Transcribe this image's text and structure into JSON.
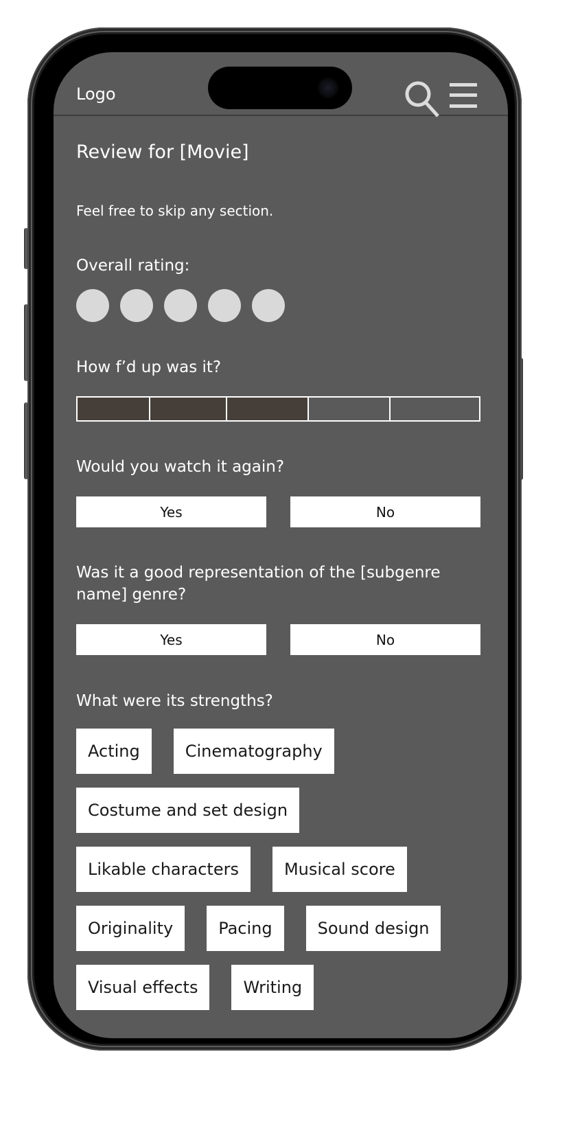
{
  "header": {
    "logo": "Logo",
    "icons": [
      "search-icon",
      "menu-icon"
    ]
  },
  "page": {
    "title": "Review for [Movie]",
    "subtitle": "Feel free to skip any section."
  },
  "overall_rating": {
    "label": "Overall rating:",
    "max": 5,
    "value": 0
  },
  "intensity": {
    "label": "How f’d up was it?",
    "segments": 5,
    "value": 3,
    "filled_color": "#463f39"
  },
  "watch_again": {
    "label": "Would you watch it again?",
    "options": [
      "Yes",
      "No"
    ]
  },
  "genre_rep": {
    "label": "Was it a good representation of the [subgenre name] genre?",
    "options": [
      "Yes",
      "No"
    ]
  },
  "strengths": {
    "label": "What were its strengths?",
    "rows": [
      [
        "Acting",
        "Cinematography"
      ],
      [
        "Costume and set design"
      ],
      [
        "Likable characters",
        "Musical score"
      ],
      [
        "Originality",
        "Pacing",
        "Sound design"
      ],
      [
        "Visual effects",
        "Writing"
      ]
    ]
  },
  "colors": {
    "screen_bg": "#5a5a5a",
    "rating_dot": "#d9d9d9",
    "button_bg": "#ffffff"
  }
}
